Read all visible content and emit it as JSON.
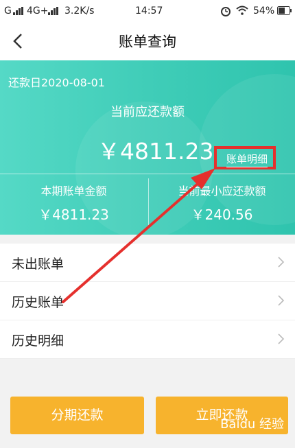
{
  "status_bar": {
    "signal_left": "G",
    "network": "4G+",
    "speed": "3.2K/s",
    "time": "14:57",
    "battery": "54%"
  },
  "nav": {
    "title": "账单查询"
  },
  "bill_card": {
    "due_date": "还款日2020-08-01",
    "current_due_label": "当前应还款额",
    "current_due_amount": "￥4811.23",
    "detail_link": "账单明细",
    "statement_amount_label": "本期账单金额",
    "statement_amount_value": "￥4811.23",
    "min_payment_label": "当前最小应还款额",
    "min_payment_value": "￥240.56"
  },
  "menu": {
    "items": [
      {
        "label": "未出账单"
      },
      {
        "label": "历史账单"
      },
      {
        "label": "历史明细"
      }
    ]
  },
  "buttons": {
    "installment": "分期还款",
    "pay_now": "立即还款"
  },
  "watermark": "Baidu 经验",
  "colors": {
    "accent_teal": "#40cdb8",
    "button_orange": "#f7b32d",
    "highlight_red": "#e5302d"
  }
}
